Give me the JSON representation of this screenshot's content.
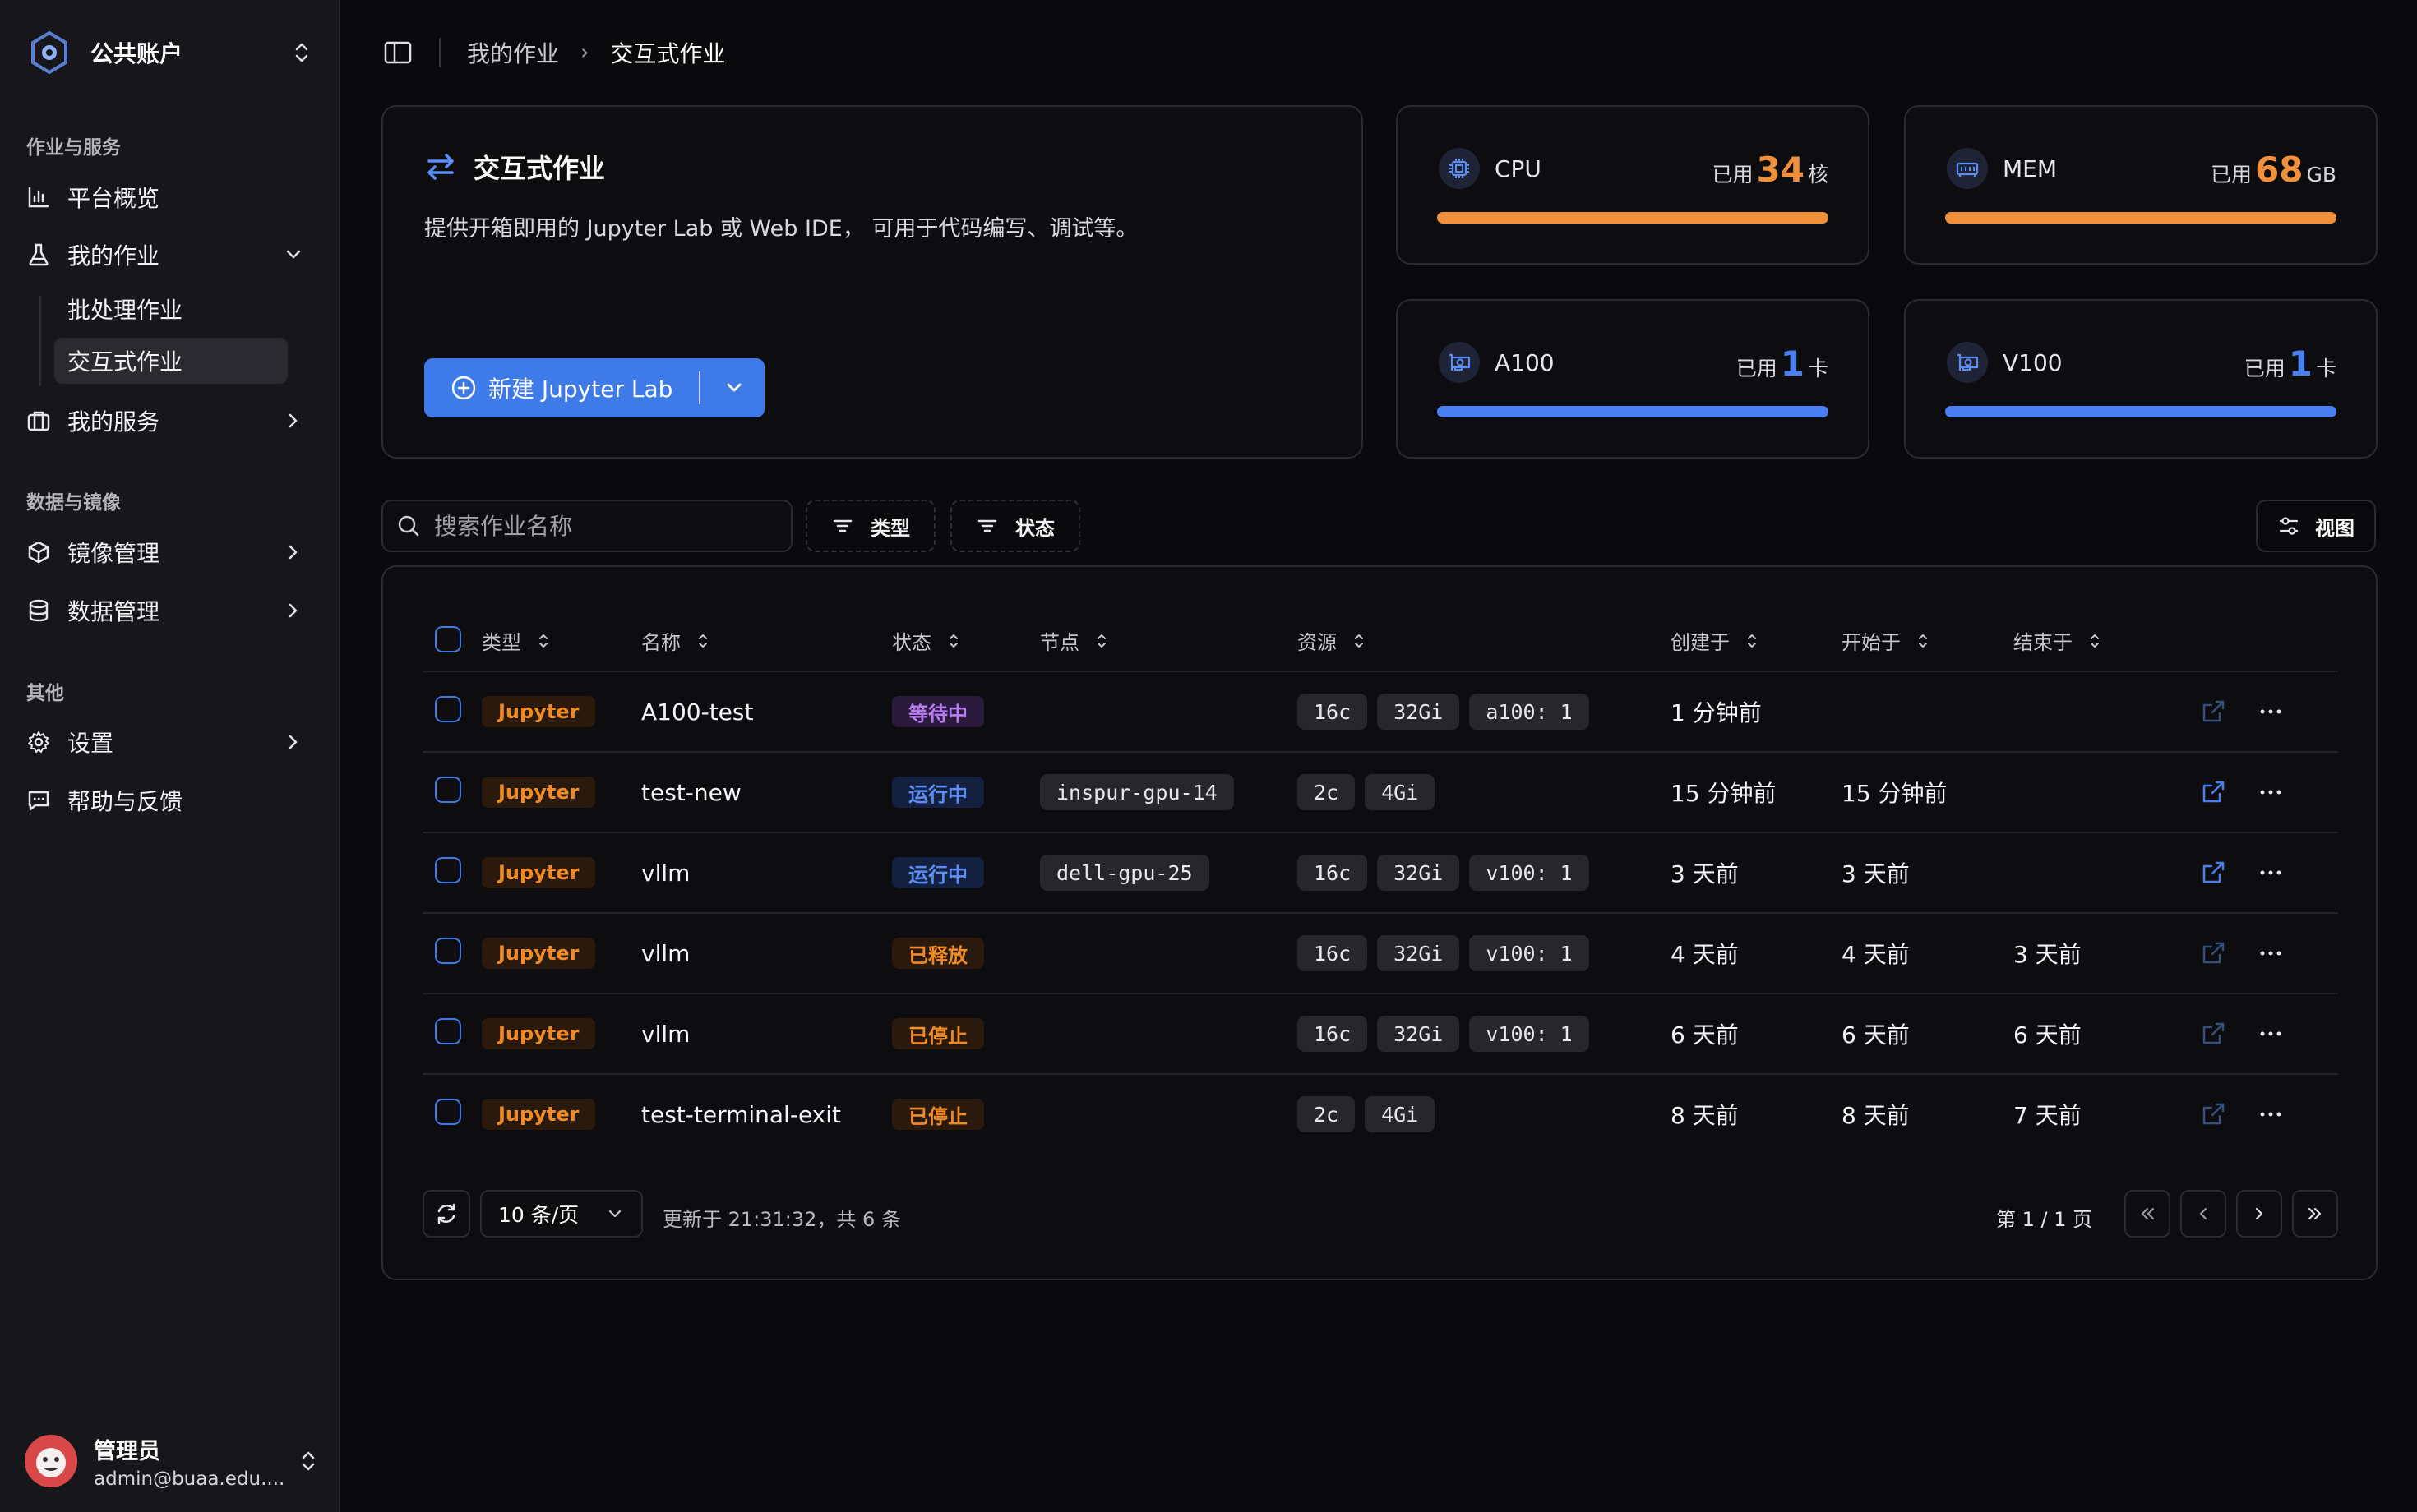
{
  "sidebar": {
    "workspace": "公共账户",
    "group_jobs": "作业与服务",
    "group_data": "数据与镜像",
    "group_other": "其他",
    "items": {
      "overview": "平台概览",
      "my_jobs": "我的作业",
      "batch": "批处理作业",
      "interactive": "交互式作业",
      "my_services": "我的服务",
      "images": "镜像管理",
      "data": "数据管理",
      "settings": "设置",
      "help": "帮助与反馈"
    },
    "user": {
      "name": "管理员",
      "email": "admin@buaa.edu...."
    }
  },
  "breadcrumb": {
    "parent": "我的作业",
    "current": "交互式作业"
  },
  "hero": {
    "title": "交互式作业",
    "description": "提供开箱即用的 Jupyter Lab 或 Web IDE， 可用于代码编写、调试等。",
    "new_button": "新建 Jupyter Lab"
  },
  "stats": [
    {
      "name": "CPU",
      "used_prefix": "已用",
      "value": "34",
      "unit": "核",
      "color": "#f0903a",
      "fill": 1.0,
      "icon": "cpu-icon"
    },
    {
      "name": "MEM",
      "used_prefix": "已用",
      "value": "68",
      "unit": "GB",
      "color": "#f0903a",
      "fill": 1.0,
      "icon": "memory-icon"
    },
    {
      "name": "A100",
      "used_prefix": "已用",
      "value": "1",
      "unit": "卡",
      "color": "#4a7ff0",
      "fill": 1.0,
      "icon": "gpu-icon"
    },
    {
      "name": "V100",
      "used_prefix": "已用",
      "value": "1",
      "unit": "卡",
      "color": "#4a7ff0",
      "fill": 1.0,
      "icon": "gpu-icon"
    }
  ],
  "toolbar": {
    "search_placeholder": "搜索作业名称",
    "filter_type": "类型",
    "filter_status": "状态",
    "view": "视图"
  },
  "table": {
    "headers": [
      "类型",
      "名称",
      "状态",
      "节点",
      "资源",
      "创建于",
      "开始于",
      "结束于"
    ],
    "rows": [
      {
        "type": "Jupyter",
        "name": "A100-test",
        "status": "等待中",
        "status_color": "#b77cf0",
        "status_bg": "#2a1a3c",
        "node": "",
        "res": [
          "16c",
          "32Gi",
          "a100: 1"
        ],
        "created": "1 分钟前",
        "started": "",
        "ended": ""
      },
      {
        "type": "Jupyter",
        "name": "test-new",
        "status": "运行中",
        "status_color": "#5b8df5",
        "status_bg": "#142040",
        "node": "inspur-gpu-14",
        "res": [
          "2c",
          "4Gi"
        ],
        "created": "15 分钟前",
        "started": "15 分钟前",
        "ended": ""
      },
      {
        "type": "Jupyter",
        "name": "vllm",
        "status": "运行中",
        "status_color": "#5b8df5",
        "status_bg": "#142040",
        "node": "dell-gpu-25",
        "res": [
          "16c",
          "32Gi",
          "v100: 1"
        ],
        "created": "3 天前",
        "started": "3 天前",
        "ended": ""
      },
      {
        "type": "Jupyter",
        "name": "vllm",
        "status": "已释放",
        "status_color": "#f08a24",
        "status_bg": "#2a1a0e",
        "node": "",
        "res": [
          "16c",
          "32Gi",
          "v100: 1"
        ],
        "created": "4 天前",
        "started": "4 天前",
        "ended": "3 天前"
      },
      {
        "type": "Jupyter",
        "name": "vllm",
        "status": "已停止",
        "status_color": "#f08a24",
        "status_bg": "#2a1a0e",
        "node": "",
        "res": [
          "16c",
          "32Gi",
          "v100: 1"
        ],
        "created": "6 天前",
        "started": "6 天前",
        "ended": "6 天前"
      },
      {
        "type": "Jupyter",
        "name": "test-terminal-exit",
        "status": "已停止",
        "status_color": "#f08a24",
        "status_bg": "#2a1a0e",
        "node": "",
        "res": [
          "2c",
          "4Gi"
        ],
        "created": "8 天前",
        "started": "8 天前",
        "ended": "7 天前"
      }
    ]
  },
  "footer": {
    "page_size": "10 条/页",
    "updated": "更新于 21:31:32，共 6 条",
    "page_info": "第 1 / 1 页"
  }
}
